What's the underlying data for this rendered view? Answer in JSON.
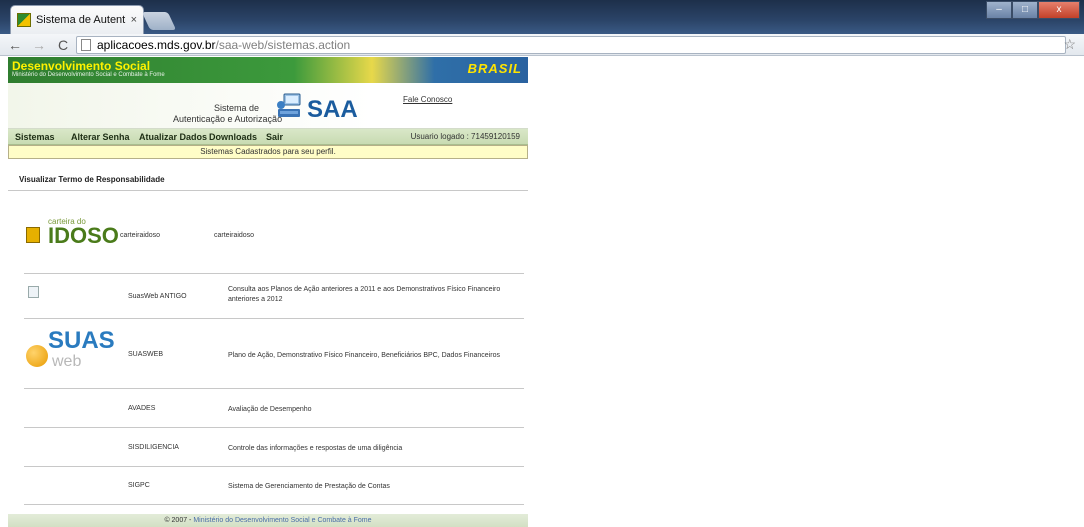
{
  "browser": {
    "tab_title": "Sistema de Autenticação",
    "tab_close": "×",
    "url_host": "aplicacoes.mds.gov.br",
    "url_path": "/saa-web/sistemas.action",
    "back": "←",
    "forward": "→",
    "reload": "C",
    "star": "☆",
    "window_controls": [
      "–",
      "□",
      "x"
    ]
  },
  "banner": {
    "title": "Desenvolvimento Social",
    "subtitle": "Ministério do Desenvolvimento Social e Combate à Fome",
    "brasil": "BRASIL"
  },
  "header": {
    "system_label_line1": "Sistema de",
    "system_label_line2": "Autenticação e Autorização",
    "logo": "SAA",
    "contact": "Fale Conosco"
  },
  "menu": {
    "items": [
      "Sistemas",
      "Alterar Senha",
      "Atualizar Dados",
      "Downloads",
      "Sair"
    ],
    "user_logged": "Usuario logado : 71459120159"
  },
  "notice": "Sistemas Cadastrados para seu perfil.",
  "term_link": "Visualizar Termo de Responsabilidade",
  "idoso_logo": {
    "small": "carteira do",
    "big": "IDOSO"
  },
  "suas_logo": {
    "big": "SUAS",
    "small": "web"
  },
  "systems": [
    {
      "name": "carteiraidoso",
      "desc": "carteiraidoso"
    },
    {
      "name": "SuasWeb ANTIGO",
      "desc": "Consulta aos Planos de Ação anteriores a 2011 e aos Demonstrativos Físico Financeiro anteriores a 2012"
    },
    {
      "name": "SUASWEB",
      "desc": "Plano de Ação, Demonstrativo Físico Financeiro, Beneficiários BPC, Dados Financeiros"
    },
    {
      "name": "AVADES",
      "desc": "Avaliação de Desempenho"
    },
    {
      "name": "SISDILIGENCIA",
      "desc": "Controle das informações e respostas de uma diligência"
    },
    {
      "name": "SIGPC",
      "desc": "Sistema de Gerenciamento de Prestação de Contas"
    }
  ],
  "footer": {
    "copyright": "© 2007 - ",
    "org": "Ministério do Desenvolvimento Social e Combate à Fome"
  }
}
